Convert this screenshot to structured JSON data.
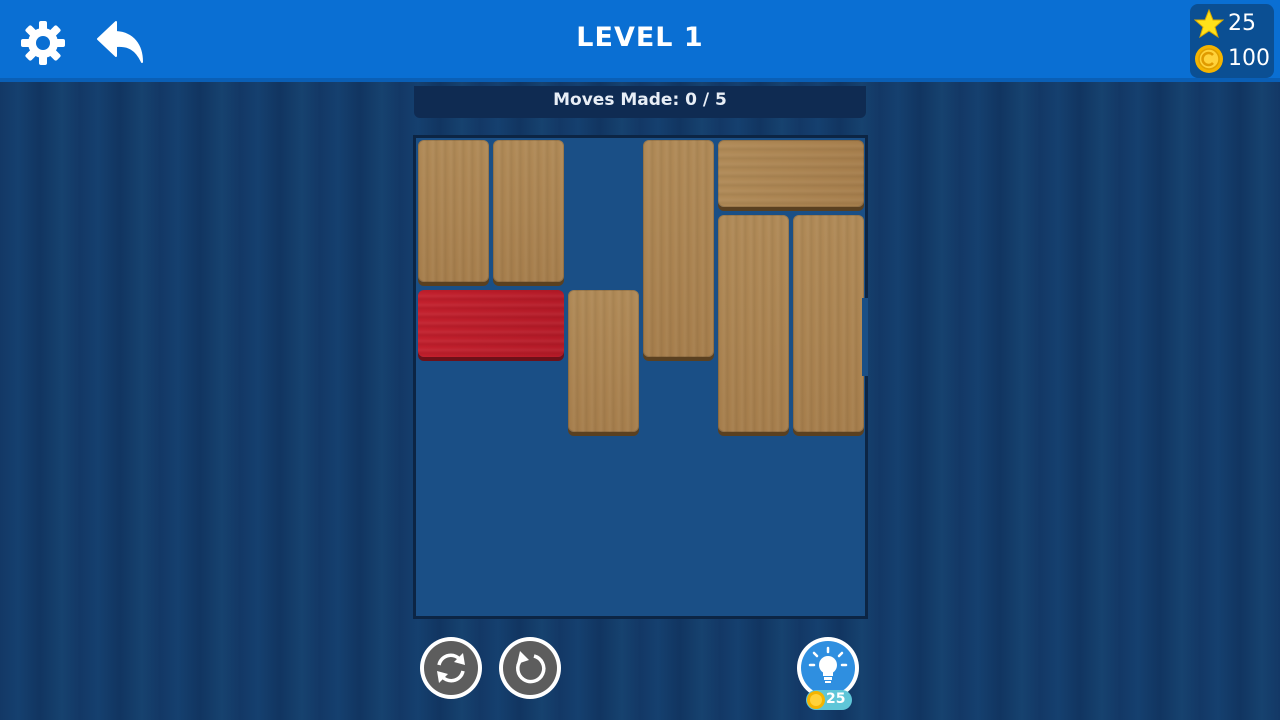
{
  "header": {
    "title": "LEVEL 1",
    "stars": "25",
    "coins": "100"
  },
  "moves": {
    "label": "Moves Made:  0 / 5"
  },
  "board": {
    "grid": {
      "cols": 6,
      "rows": 6
    },
    "blocks": [
      {
        "kind": "wood",
        "orientation": "vertical",
        "col": 0,
        "row": 0,
        "length": 2
      },
      {
        "kind": "wood",
        "orientation": "vertical",
        "col": 1,
        "row": 0,
        "length": 2
      },
      {
        "kind": "wood",
        "orientation": "vertical",
        "col": 3,
        "row": 0,
        "length": 3
      },
      {
        "kind": "wood",
        "orientation": "horizontal",
        "col": 4,
        "row": 0,
        "length": 2
      },
      {
        "kind": "wood",
        "orientation": "vertical",
        "col": 4,
        "row": 1,
        "length": 3
      },
      {
        "kind": "wood",
        "orientation": "vertical",
        "col": 5,
        "row": 1,
        "length": 3
      },
      {
        "kind": "target",
        "orientation": "horizontal",
        "col": 0,
        "row": 2,
        "length": 2
      },
      {
        "kind": "wood",
        "orientation": "vertical",
        "col": 2,
        "row": 2,
        "length": 2
      }
    ]
  },
  "controls": {
    "restart_icon": "restart-icon",
    "undo_icon": "undo-icon",
    "hint_icon": "lightbulb-icon",
    "hint_cost": "25"
  },
  "colors": {
    "topbar": "#0a6fd3",
    "target_block": "#c21f2c",
    "wood_block": "#b08a57"
  }
}
